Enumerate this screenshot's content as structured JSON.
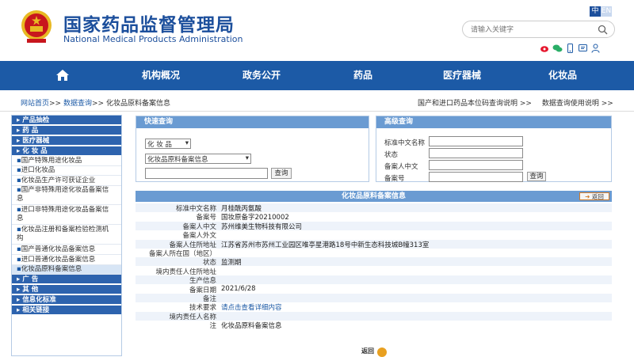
{
  "header": {
    "site_name_cn": "国家药品监督管理局",
    "site_name_en": "National Medical Products Administration",
    "lang_zh": "中",
    "lang_en": "EN",
    "search_placeholder": "请输入关键字"
  },
  "nav": {
    "items": [
      "机构概况",
      "政务公开",
      "药品",
      "医疗器械",
      "化妆品"
    ]
  },
  "breadcrumb": {
    "home": "网站首页",
    "data_query": "数据查询",
    "current": "化妆品原料备案信息",
    "sep": ">>",
    "right_links": [
      "国产和进口药品本位码查询说明 >>",
      "数据查询使用说明 >>"
    ]
  },
  "sidebar": {
    "items": [
      {
        "label": "产品抽检",
        "type": "cat"
      },
      {
        "label": "药    品",
        "type": "cat"
      },
      {
        "label": "医疗器械",
        "type": "cat"
      },
      {
        "label": "化 妆 品",
        "type": "cat"
      },
      {
        "label": "国产特殊用途化妆品",
        "type": "sub"
      },
      {
        "label": "进口化妆品",
        "type": "sub"
      },
      {
        "label": "化妆品生产许可获证企业",
        "type": "sub"
      },
      {
        "label": "国产非特殊用途化妆品备案信",
        "type": "sub2",
        "label2": "息"
      },
      {
        "label": "进口非特殊用途化妆品备案信",
        "type": "sub2",
        "label2": "息"
      },
      {
        "label": "化妆品注册和备案检验检测机",
        "type": "sub2",
        "label2": "构"
      },
      {
        "label": "国产普通化妆品备案信息",
        "type": "sub"
      },
      {
        "label": "进口普通化妆品备案信息",
        "type": "sub"
      },
      {
        "label": "化妆品原料备案信息",
        "type": "sub",
        "active": true
      },
      {
        "label": "广    告",
        "type": "cat"
      },
      {
        "label": "其    他",
        "type": "cat"
      },
      {
        "label": "信息化标准",
        "type": "cat"
      },
      {
        "label": "相关链接",
        "type": "cat"
      }
    ]
  },
  "quick": {
    "title": "快速查询",
    "category_value": "化 妆 品",
    "db_value": "化妆品原料备案信息",
    "query_label": "查询"
  },
  "advanced": {
    "title": "高级查询",
    "fields": [
      "标准中文名称",
      "状态",
      "备案人中文",
      "备案号"
    ],
    "query_label": "查询"
  },
  "detail": {
    "title": "化妆品原料备案信息",
    "back_label": "返回",
    "rows": [
      {
        "k": "标准中文名称",
        "v": "月桂酰丙氨酸"
      },
      {
        "k": "备案号",
        "v": "国妆原备字20210002"
      },
      {
        "k": "备案人中文",
        "v": "苏州维美生物科技有限公司"
      },
      {
        "k": "备案人外文",
        "v": ""
      },
      {
        "k": "备案人住所地址",
        "v": "江苏省苏州市苏州工业园区唯亭星港路18号中新生态科技城B幢313室"
      },
      {
        "k": "备案人所在国（地区）",
        "v": ""
      },
      {
        "k": "状态",
        "v": "监测期"
      },
      {
        "k": "境内责任人住所地址",
        "v": ""
      },
      {
        "k": "生产信息",
        "v": ""
      },
      {
        "k": "备案日期",
        "v": "2021/6/28"
      },
      {
        "k": "备注",
        "v": ""
      },
      {
        "k": "技术要求",
        "v": "请点击查看详细内容",
        "link": true
      },
      {
        "k": "境内责任人名称",
        "v": ""
      },
      {
        "k": "注",
        "v": "化妆品原料备案信息"
      }
    ],
    "back_bottom_label": "返回"
  },
  "colors": {
    "brand": "#1c5aa6",
    "panel_head": "#6a9bd2",
    "emblem_red": "#c8161d",
    "emblem_gold": "#e8b923"
  }
}
